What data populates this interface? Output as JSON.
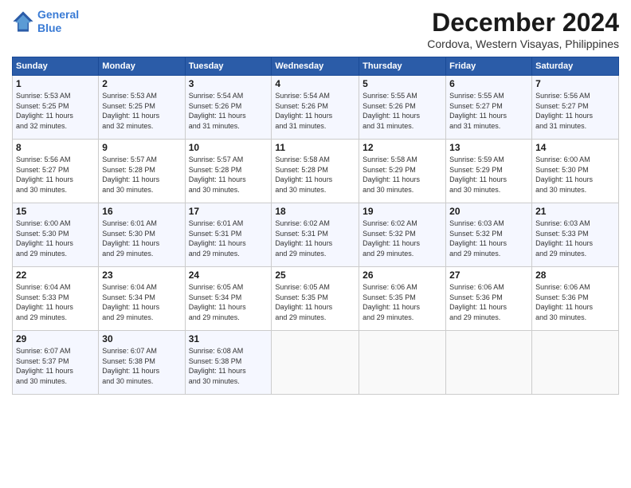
{
  "header": {
    "logo_line1": "General",
    "logo_line2": "Blue",
    "main_title": "December 2024",
    "subtitle": "Cordova, Western Visayas, Philippines"
  },
  "calendar": {
    "days_of_week": [
      "Sunday",
      "Monday",
      "Tuesday",
      "Wednesday",
      "Thursday",
      "Friday",
      "Saturday"
    ],
    "weeks": [
      [
        {
          "day": "1",
          "info": "Sunrise: 5:53 AM\nSunset: 5:25 PM\nDaylight: 11 hours\nand 32 minutes."
        },
        {
          "day": "2",
          "info": "Sunrise: 5:53 AM\nSunset: 5:25 PM\nDaylight: 11 hours\nand 32 minutes."
        },
        {
          "day": "3",
          "info": "Sunrise: 5:54 AM\nSunset: 5:26 PM\nDaylight: 11 hours\nand 31 minutes."
        },
        {
          "day": "4",
          "info": "Sunrise: 5:54 AM\nSunset: 5:26 PM\nDaylight: 11 hours\nand 31 minutes."
        },
        {
          "day": "5",
          "info": "Sunrise: 5:55 AM\nSunset: 5:26 PM\nDaylight: 11 hours\nand 31 minutes."
        },
        {
          "day": "6",
          "info": "Sunrise: 5:55 AM\nSunset: 5:27 PM\nDaylight: 11 hours\nand 31 minutes."
        },
        {
          "day": "7",
          "info": "Sunrise: 5:56 AM\nSunset: 5:27 PM\nDaylight: 11 hours\nand 31 minutes."
        }
      ],
      [
        {
          "day": "8",
          "info": "Sunrise: 5:56 AM\nSunset: 5:27 PM\nDaylight: 11 hours\nand 30 minutes."
        },
        {
          "day": "9",
          "info": "Sunrise: 5:57 AM\nSunset: 5:28 PM\nDaylight: 11 hours\nand 30 minutes."
        },
        {
          "day": "10",
          "info": "Sunrise: 5:57 AM\nSunset: 5:28 PM\nDaylight: 11 hours\nand 30 minutes."
        },
        {
          "day": "11",
          "info": "Sunrise: 5:58 AM\nSunset: 5:28 PM\nDaylight: 11 hours\nand 30 minutes."
        },
        {
          "day": "12",
          "info": "Sunrise: 5:58 AM\nSunset: 5:29 PM\nDaylight: 11 hours\nand 30 minutes."
        },
        {
          "day": "13",
          "info": "Sunrise: 5:59 AM\nSunset: 5:29 PM\nDaylight: 11 hours\nand 30 minutes."
        },
        {
          "day": "14",
          "info": "Sunrise: 6:00 AM\nSunset: 5:30 PM\nDaylight: 11 hours\nand 30 minutes."
        }
      ],
      [
        {
          "day": "15",
          "info": "Sunrise: 6:00 AM\nSunset: 5:30 PM\nDaylight: 11 hours\nand 29 minutes."
        },
        {
          "day": "16",
          "info": "Sunrise: 6:01 AM\nSunset: 5:30 PM\nDaylight: 11 hours\nand 29 minutes."
        },
        {
          "day": "17",
          "info": "Sunrise: 6:01 AM\nSunset: 5:31 PM\nDaylight: 11 hours\nand 29 minutes."
        },
        {
          "day": "18",
          "info": "Sunrise: 6:02 AM\nSunset: 5:31 PM\nDaylight: 11 hours\nand 29 minutes."
        },
        {
          "day": "19",
          "info": "Sunrise: 6:02 AM\nSunset: 5:32 PM\nDaylight: 11 hours\nand 29 minutes."
        },
        {
          "day": "20",
          "info": "Sunrise: 6:03 AM\nSunset: 5:32 PM\nDaylight: 11 hours\nand 29 minutes."
        },
        {
          "day": "21",
          "info": "Sunrise: 6:03 AM\nSunset: 5:33 PM\nDaylight: 11 hours\nand 29 minutes."
        }
      ],
      [
        {
          "day": "22",
          "info": "Sunrise: 6:04 AM\nSunset: 5:33 PM\nDaylight: 11 hours\nand 29 minutes."
        },
        {
          "day": "23",
          "info": "Sunrise: 6:04 AM\nSunset: 5:34 PM\nDaylight: 11 hours\nand 29 minutes."
        },
        {
          "day": "24",
          "info": "Sunrise: 6:05 AM\nSunset: 5:34 PM\nDaylight: 11 hours\nand 29 minutes."
        },
        {
          "day": "25",
          "info": "Sunrise: 6:05 AM\nSunset: 5:35 PM\nDaylight: 11 hours\nand 29 minutes."
        },
        {
          "day": "26",
          "info": "Sunrise: 6:06 AM\nSunset: 5:35 PM\nDaylight: 11 hours\nand 29 minutes."
        },
        {
          "day": "27",
          "info": "Sunrise: 6:06 AM\nSunset: 5:36 PM\nDaylight: 11 hours\nand 29 minutes."
        },
        {
          "day": "28",
          "info": "Sunrise: 6:06 AM\nSunset: 5:36 PM\nDaylight: 11 hours\nand 30 minutes."
        }
      ],
      [
        {
          "day": "29",
          "info": "Sunrise: 6:07 AM\nSunset: 5:37 PM\nDaylight: 11 hours\nand 30 minutes."
        },
        {
          "day": "30",
          "info": "Sunrise: 6:07 AM\nSunset: 5:38 PM\nDaylight: 11 hours\nand 30 minutes."
        },
        {
          "day": "31",
          "info": "Sunrise: 6:08 AM\nSunset: 5:38 PM\nDaylight: 11 hours\nand 30 minutes."
        },
        {
          "day": "",
          "info": ""
        },
        {
          "day": "",
          "info": ""
        },
        {
          "day": "",
          "info": ""
        },
        {
          "day": "",
          "info": ""
        }
      ]
    ]
  }
}
